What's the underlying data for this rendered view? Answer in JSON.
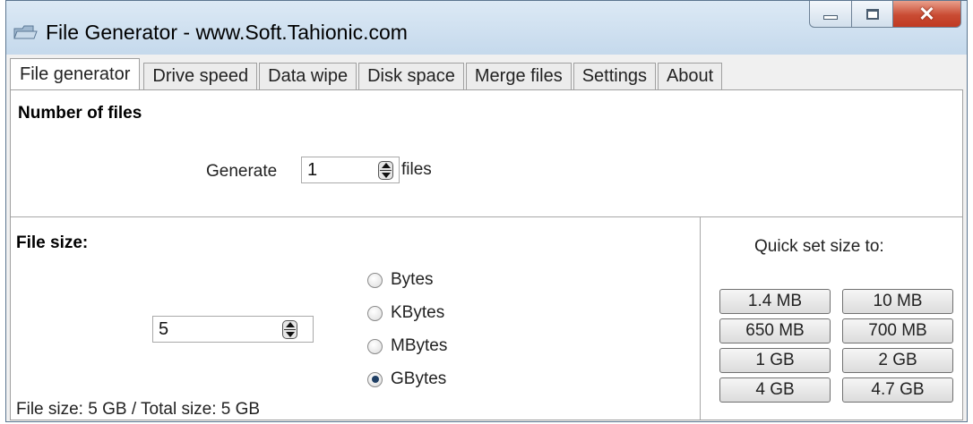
{
  "window": {
    "title": "File Generator  -  www.Soft.Tahionic.com",
    "close_glyph": "✕",
    "app_icon": "folder-icon"
  },
  "tabs": [
    {
      "label": "File generator",
      "active": true
    },
    {
      "label": "Drive speed"
    },
    {
      "label": "Data wipe"
    },
    {
      "label": "Disk space"
    },
    {
      "label": "Merge files"
    },
    {
      "label": "Settings"
    },
    {
      "label": "About"
    }
  ],
  "number_of_files": {
    "title": "Number of files",
    "generate_label": "Generate",
    "value": "1",
    "suffix": "files"
  },
  "file_size": {
    "title": "File size:",
    "value": "5",
    "units": [
      {
        "label": "Bytes",
        "selected": false
      },
      {
        "label": "KBytes",
        "selected": false
      },
      {
        "label": "MBytes",
        "selected": false
      },
      {
        "label": "GBytes",
        "selected": true
      }
    ],
    "status": "File size: 5 GB / Total size: 5 GB"
  },
  "quick_set": {
    "title": "Quick set size to:",
    "buttons": [
      "1.4 MB",
      "10 MB",
      "650 MB",
      "700 MB",
      "1 GB",
      "2 GB",
      "4 GB",
      "4.7 GB"
    ]
  },
  "colors": {
    "title_bar": "#c5d9ec",
    "close_button": "#c94b33",
    "radio_selected": "#1f3f64"
  }
}
